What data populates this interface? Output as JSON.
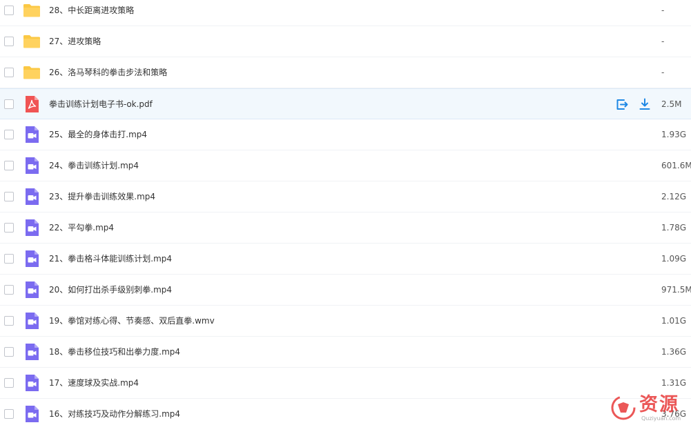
{
  "accent_color": "#1e88e5",
  "colors": {
    "folder": "#fbc844",
    "pdf": "#f05454",
    "video": "#7b6bf0",
    "row_highlight": "#f2f8fd"
  },
  "files": [
    {
      "type": "folder",
      "icon": "folder-icon",
      "name": "28、中长距离进攻策略",
      "size": "-"
    },
    {
      "type": "folder",
      "icon": "folder-icon",
      "name": "27、进攻策略",
      "size": "-"
    },
    {
      "type": "folder",
      "icon": "folder-icon",
      "name": "26、洛马琴科的拳击步法和策略",
      "size": "-"
    },
    {
      "type": "pdf",
      "icon": "pdf-icon",
      "name": "拳击训练计划电子书-ok.pdf",
      "size": "2.5M",
      "highlighted": true,
      "actions": [
        "share-icon",
        "download-icon"
      ]
    },
    {
      "type": "video",
      "icon": "video-icon",
      "name": "25、最全的身体击打.mp4",
      "size": "1.93G"
    },
    {
      "type": "video",
      "icon": "video-icon",
      "name": "24、拳击训练计划.mp4",
      "size": "601.6M"
    },
    {
      "type": "video",
      "icon": "video-icon",
      "name": "23、提升拳击训练效果.mp4",
      "size": "2.12G"
    },
    {
      "type": "video",
      "icon": "video-icon",
      "name": "22、平勾拳.mp4",
      "size": "1.78G"
    },
    {
      "type": "video",
      "icon": "video-icon",
      "name": "21、拳击格斗体能训练计划.mp4",
      "size": "1.09G"
    },
    {
      "type": "video",
      "icon": "video-icon",
      "name": "20、如何打出杀手级别刺拳.mp4",
      "size": "971.5M"
    },
    {
      "type": "video",
      "icon": "video-icon",
      "name": "19、拳馆对练心得、节奏感、双后直拳.wmv",
      "size": "1.01G"
    },
    {
      "type": "video",
      "icon": "video-icon",
      "name": "18、拳击移位技巧和出拳力度.mp4",
      "size": "1.36G"
    },
    {
      "type": "video",
      "icon": "video-icon",
      "name": "17、速度球及实战.mp4",
      "size": "1.31G"
    },
    {
      "type": "video",
      "icon": "video-icon",
      "name": "16、对练技巧及动作分解练习.mp4",
      "size": "3.76G"
    }
  ],
  "watermark": {
    "text": "资源",
    "domain": "Quziyuan.com"
  }
}
